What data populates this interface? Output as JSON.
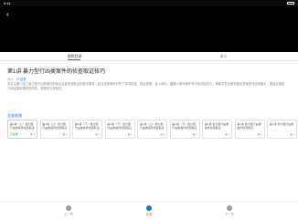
{
  "status": {
    "time": "9:41"
  },
  "tabs": [
    {
      "label": "视频目录"
    },
    {
      "label": "讲义"
    }
  ],
  "course": {
    "title": "第1讲 暴力型行凶类案件的侦查取证技巧",
    "meta_label": "共计",
    "meta_count": "1个目录",
    "description": "本讲主要介绍了暴力型行凶类案件的特点及其侦查取证的基本要求，结合具体案例分析了现场勘查、物证提取、证人询问、嫌疑人审讯等环节中的关键技巧，帮助学员全面掌握此类案件的侦查要点，提高办案能力和证据收集的规范性、完整性与有效性。"
  },
  "section": {
    "title": "全部视频"
  },
  "cards": [
    {
      "title": "第1讲（上）暴力型行凶类案件侦查取证技巧",
      "status": "已完成",
      "plays": "1",
      "active": true
    },
    {
      "title": "第1讲（上）暴力型行凶类案件侦查取证技巧",
      "status": "",
      "plays": "1"
    },
    {
      "title": "第1讲（下）暴力型行凶类案件侦查取证技巧",
      "status": "",
      "plays": "1"
    },
    {
      "title": "第1讲（下）暴力型行凶类案件侦查取证技巧",
      "status": "",
      "plays": "1"
    },
    {
      "title": "第1讲（上）暴力型行凶类案件侦查取证技巧",
      "status": "",
      "plays": "1"
    },
    {
      "title": "第1讲（下）暴力型行凶类案件侦查取证技巧",
      "status": "",
      "plays": "1"
    },
    {
      "title": "第1讲 暴力型行凶类案件侦查取证",
      "status": "",
      "plays": "1"
    },
    {
      "title": "第1讲 暴力型行凶类案件侦查取证",
      "status": "",
      "plays": "1"
    },
    {
      "title": "第1讲 暴力型行凶类",
      "status": "",
      "plays": "1"
    }
  ],
  "bottom_nav": [
    {
      "label": "上一节"
    },
    {
      "label": "目录"
    },
    {
      "label": "下一节"
    }
  ]
}
